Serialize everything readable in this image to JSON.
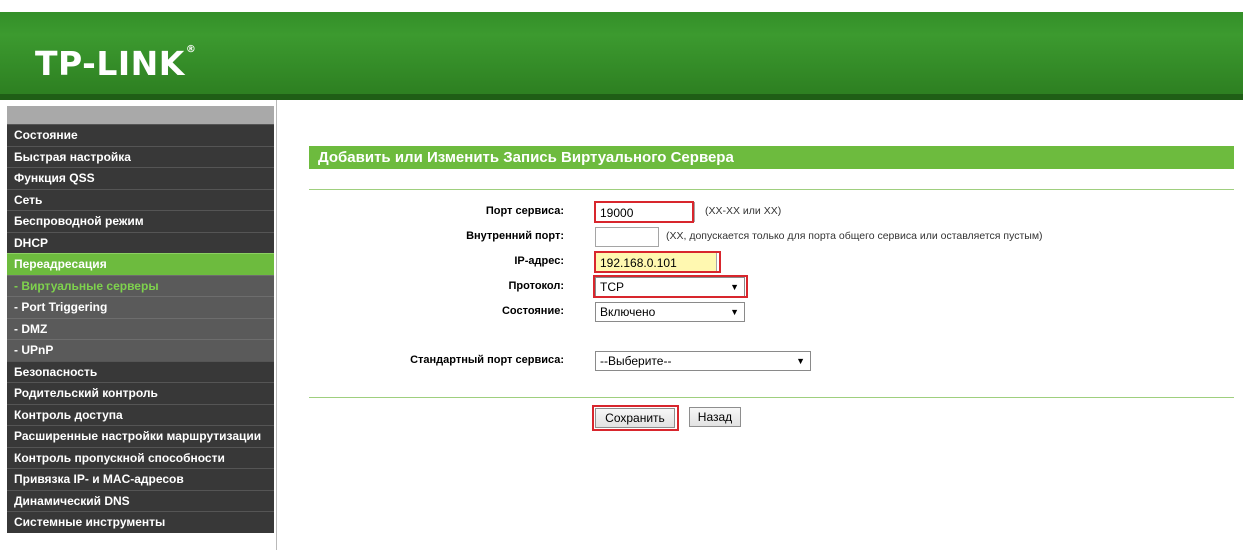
{
  "header": {
    "logo": "TP-LINK",
    "logo_mark": "®"
  },
  "sidebar": {
    "items": [
      {
        "label": "Состояние",
        "type": "main"
      },
      {
        "label": "Быстрая настройка",
        "type": "main"
      },
      {
        "label": "Функция QSS",
        "type": "main"
      },
      {
        "label": "Сеть",
        "type": "main"
      },
      {
        "label": "Беспроводной режим",
        "type": "main"
      },
      {
        "label": "DHCP",
        "type": "main"
      },
      {
        "label": "Переадресация",
        "type": "active"
      },
      {
        "label": "- Виртуальные серверы",
        "type": "sub-current"
      },
      {
        "label": "- Port Triggering",
        "type": "sub"
      },
      {
        "label": "- DMZ",
        "type": "sub"
      },
      {
        "label": "- UPnP",
        "type": "sub"
      },
      {
        "label": "Безопасность",
        "type": "main"
      },
      {
        "label": "Родительский контроль",
        "type": "main"
      },
      {
        "label": "Контроль доступа",
        "type": "main"
      },
      {
        "label": "Расширенные настройки маршрутизации",
        "type": "main"
      },
      {
        "label": "Контроль пропускной способности",
        "type": "main"
      },
      {
        "label": "Привязка IP- и MAC-адресов",
        "type": "main"
      },
      {
        "label": "Динамический DNS",
        "type": "main"
      },
      {
        "label": "Системные инструменты",
        "type": "main"
      }
    ]
  },
  "page": {
    "title": "Добавить или Изменить Запись Виртуального Сервера"
  },
  "form": {
    "service_port": {
      "label": "Порт сервиса:",
      "value": "19000",
      "hint": "(XX-XX или XX)"
    },
    "internal_port": {
      "label": "Внутренний порт:",
      "value": "",
      "hint": "(XX, допускается только для порта общего сервиса или оставляется пустым)"
    },
    "ip_address": {
      "label": "IP-адрес:",
      "value": "192.168.0.101"
    },
    "protocol": {
      "label": "Протокол:",
      "value": "TCP"
    },
    "status": {
      "label": "Состояние:",
      "value": "Включено"
    },
    "common_port": {
      "label": "Стандартный порт сервиса:",
      "value": "--Выберите--"
    }
  },
  "buttons": {
    "save": "Сохранить",
    "back": "Назад"
  },
  "colors": {
    "brand_green": "#6dbb3e",
    "highlight_red": "#d8262d",
    "sidebar_dark": "#383838"
  }
}
